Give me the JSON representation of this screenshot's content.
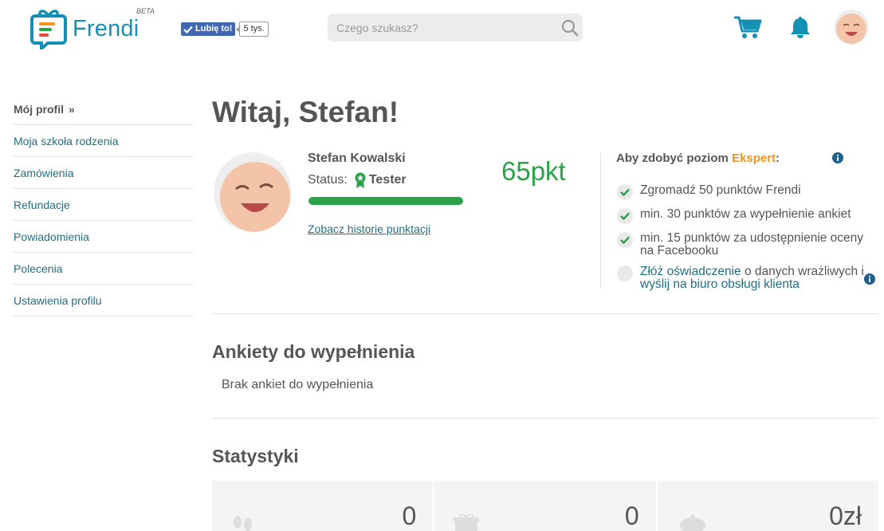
{
  "header": {
    "logo_text": "Frendi",
    "logo_badge": "BETA",
    "fb_like_label": "Lubię to!",
    "fb_like_count": "5 tys.",
    "search_placeholder": "Czego szukasz?",
    "icons": [
      "search-icon",
      "cart-icon",
      "bell-icon"
    ]
  },
  "sidebar": {
    "items": [
      {
        "label": "Mój profil",
        "suffix": "»",
        "active": true
      },
      {
        "label": "Moja szkoła rodzenia"
      },
      {
        "label": "Zamówienia"
      },
      {
        "label": "Refundacje"
      },
      {
        "label": "Powiadomienia"
      },
      {
        "label": "Polecenia"
      },
      {
        "label": "Ustawienia profilu"
      }
    ]
  },
  "main": {
    "greeting": "Witaj, Stefan!",
    "profile": {
      "name": "Stefan Kowalski",
      "status_label": "Status:",
      "status_value": "Tester",
      "progress_fraction": 1.0,
      "history_link": "Zobacz historię punktacji",
      "points": "65pkt"
    },
    "requirements": {
      "title_prefix": "Aby zdobyć poziom ",
      "level": "Ekspert",
      "title_suffix": ":",
      "items": [
        {
          "text": "Zgromadź 50 punktów Frendi",
          "done": true
        },
        {
          "text": "min. 30 punktów za wypełnienie ankiet",
          "done": true
        },
        {
          "text": "min. 15 punktów za udostępnienie oceny na Facebooku",
          "done": true
        },
        {
          "link1": "Złóż oświadczenie",
          "mid": " o danych wrażliwych i ",
          "link2": "wyślij na biuro obsługi klienta",
          "done": false
        }
      ]
    },
    "surveys": {
      "title": "Ankiety do wypełnienia",
      "empty": "Brak ankiet do wypełnienia"
    },
    "stats": {
      "title": "Statystyki",
      "items": [
        {
          "value": "0",
          "icon": "footprints-icon"
        },
        {
          "value": "0",
          "icon": "gift-icon"
        },
        {
          "value": "0zł",
          "icon": "piggy-bank-icon"
        }
      ]
    }
  },
  "colors": {
    "brand_blue": "#1590b5",
    "link": "#1f6e86",
    "green": "#2aa348",
    "orange": "#f7941d"
  }
}
